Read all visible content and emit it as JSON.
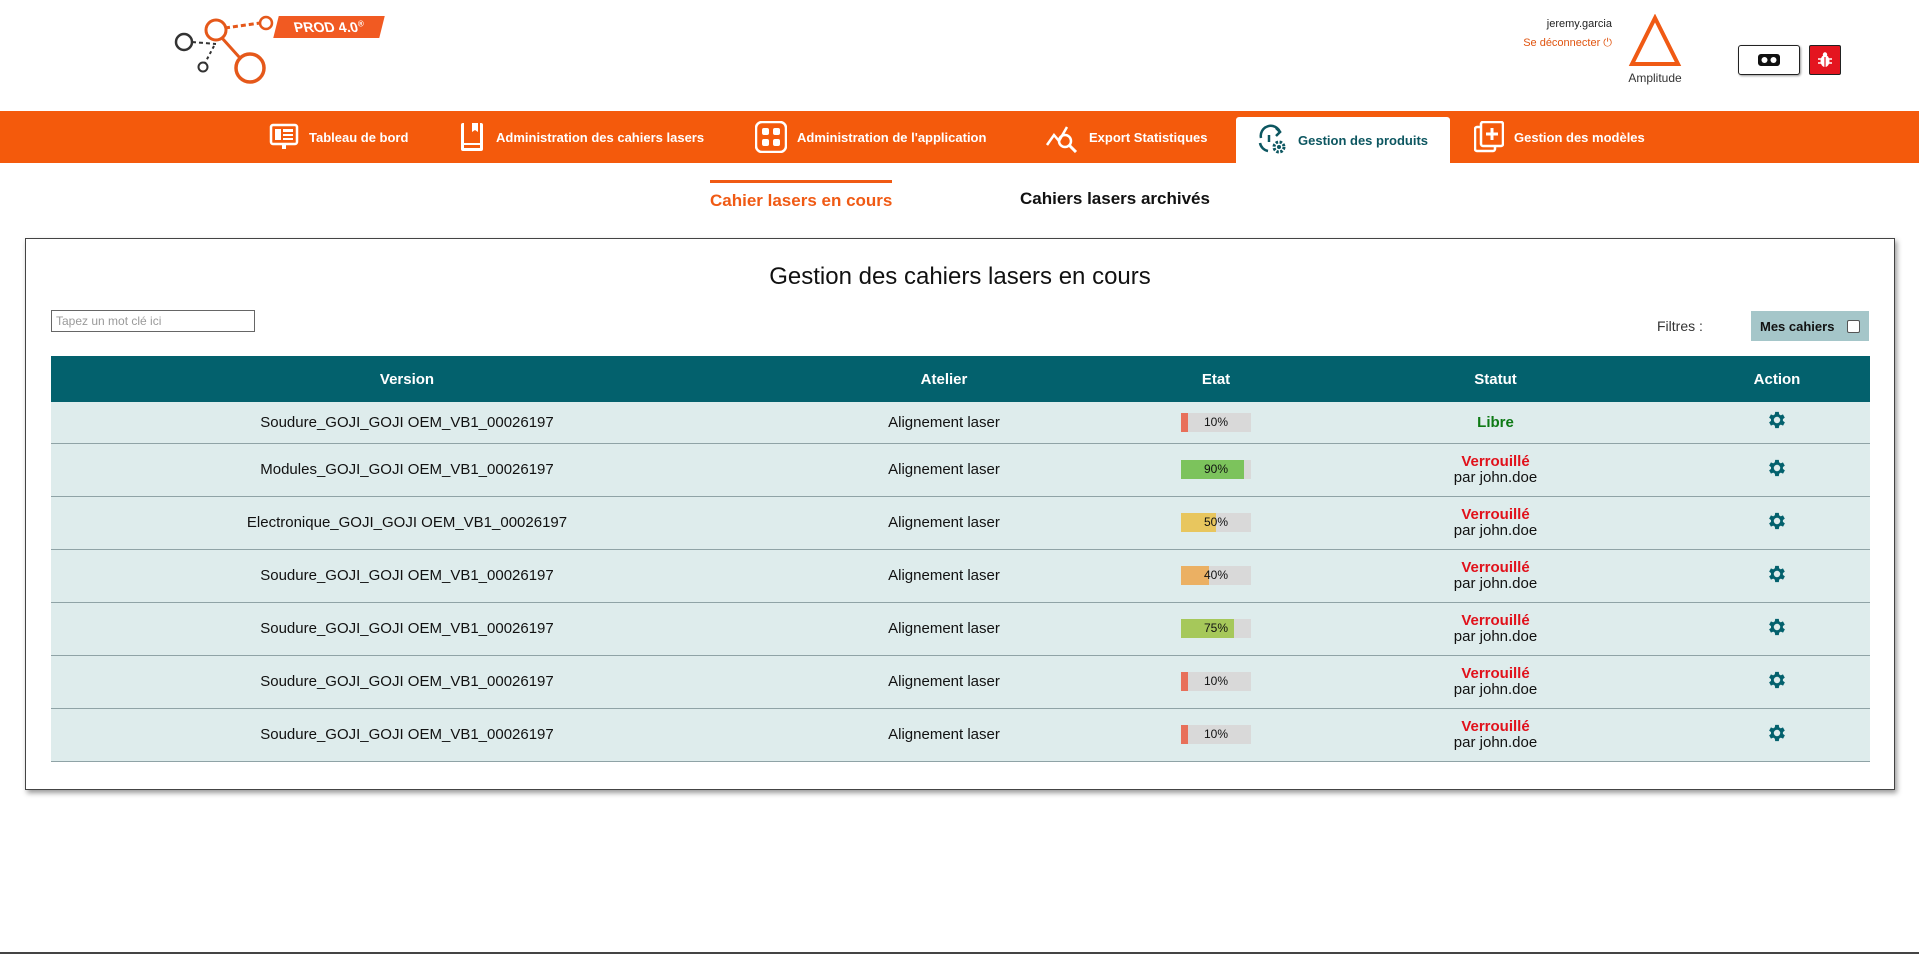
{
  "header": {
    "badge": "PROD 4.0",
    "badge_sup": "®",
    "username": "jeremy.garcia",
    "logout": "Se déconnecter ⏻",
    "brand": "Amplitude"
  },
  "nav": {
    "items": [
      {
        "label": "Tableau de bord",
        "icon": "dashboard-icon"
      },
      {
        "label": "Administration des cahiers lasers",
        "icon": "book-icon"
      },
      {
        "label": "Administration de l'application",
        "icon": "grid-icon"
      },
      {
        "label": "Export Statistiques",
        "icon": "chart-search-icon"
      },
      {
        "label": "Gestion des produits",
        "icon": "product-settings-icon",
        "active": true
      },
      {
        "label": "Gestion des modèles",
        "icon": "add-document-icon"
      }
    ]
  },
  "subtabs": {
    "current": "Cahier lasers en cours",
    "archived": "Cahiers lasers archivés"
  },
  "panel": {
    "title": "Gestion des cahiers lasers en cours",
    "search_placeholder": "Tapez un mot clé ici",
    "filters_label": "Filtres :",
    "mes_cahiers": "Mes cahiers"
  },
  "table": {
    "headers": [
      "Version",
      "Atelier",
      "Etat",
      "Statut",
      "Action"
    ],
    "rows": [
      {
        "version": "Soudure_GOJI_GOJI OEM_VB1_00026197",
        "atelier": "Alignement laser",
        "progress": 10,
        "pct": "10%",
        "color": "#e8705a",
        "statut": "Libre",
        "by": ""
      },
      {
        "version": "Modules_GOJI_GOJI OEM_VB1_00026197",
        "atelier": "Alignement laser",
        "progress": 90,
        "pct": "90%",
        "color": "#7cc35c",
        "statut": "Verrouillé",
        "by": "par john.doe"
      },
      {
        "version": "Electronique_GOJI_GOJI OEM_VB1_00026197",
        "atelier": "Alignement laser",
        "progress": 50,
        "pct": "50%",
        "color": "#e8c65e",
        "statut": "Verrouillé",
        "by": "par john.doe"
      },
      {
        "version": "Soudure_GOJI_GOJI OEM_VB1_00026197",
        "atelier": "Alignement laser",
        "progress": 40,
        "pct": "40%",
        "color": "#ebb063",
        "statut": "Verrouillé",
        "by": "par john.doe"
      },
      {
        "version": "Soudure_GOJI_GOJI OEM_VB1_00026197",
        "atelier": "Alignement laser",
        "progress": 75,
        "pct": "75%",
        "color": "#a6c85a",
        "statut": "Verrouillé",
        "by": "par john.doe"
      },
      {
        "version": "Soudure_GOJI_GOJI OEM_VB1_00026197",
        "atelier": "Alignement laser",
        "progress": 10,
        "pct": "10%",
        "color": "#e8705a",
        "statut": "Verrouillé",
        "by": "par john.doe"
      },
      {
        "version": "Soudure_GOJI_GOJI OEM_VB1_00026197",
        "atelier": "Alignement laser",
        "progress": 10,
        "pct": "10%",
        "color": "#e8705a",
        "statut": "Verrouillé",
        "by": "par john.doe"
      }
    ]
  },
  "colors": {
    "accent": "#f45a0c",
    "table_header": "#03616d",
    "row_bg": "#deecec",
    "libre": "#0e7a15",
    "locked": "#e1111b",
    "gear": "#03616d"
  }
}
